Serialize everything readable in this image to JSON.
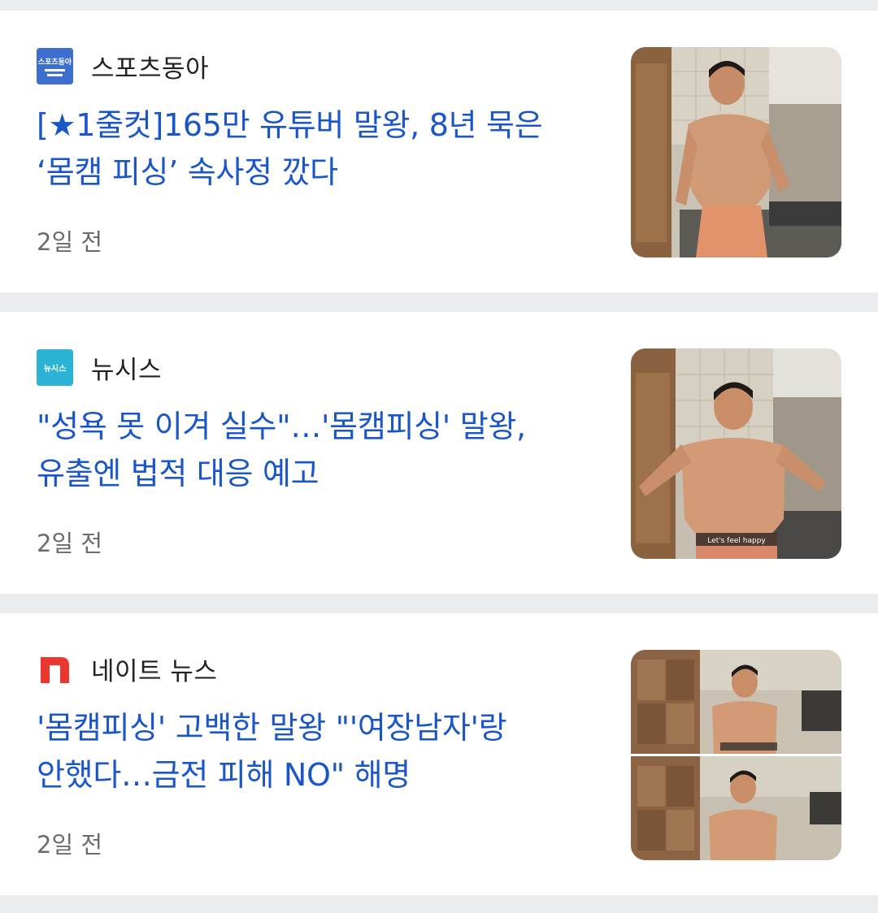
{
  "articles": [
    {
      "source": "스포츠동아",
      "logo_text": "스포츠동아",
      "logo_icon": "sportsdonga-logo-icon",
      "headline_line1": "[★1줄컷]165만 유튜버 말왕, 8년 묵은",
      "headline_line2": "‘몸캠 피싱’ 속사정 깠다",
      "time": "2일 전",
      "thumbnail": "shirtless-man-in-kitchen-photo"
    },
    {
      "source": "뉴시스",
      "logo_text": "뉴시스",
      "logo_icon": "newsis-logo-icon",
      "headline_line1": "\"성욕 못 이겨 실수\"…'몸캠피싱' 말왕,",
      "headline_line2": "유출엔 법적 대응 예고",
      "time": "2일 전",
      "thumbnail": "shirtless-man-in-kitchen-photo",
      "caption": "Let's feel happy"
    },
    {
      "source": "네이트 뉴스",
      "logo_icon": "nate-logo-icon",
      "headline_line1": "'몸캠피싱' 고백한 말왕 \"'여장남자'랑",
      "headline_line2": "안했다…금전 피해 NO\" 해명",
      "time": "2일 전",
      "thumbnail": "shirtless-man-collage-photo"
    }
  ],
  "colors": {
    "headline": "#1a56c7",
    "background": "#ebecef",
    "card": "#ffffff",
    "sportsdonga_logo": "#3d6fd0",
    "newsis_logo": "#2bb3d6",
    "nate_logo": "#e8382f"
  }
}
